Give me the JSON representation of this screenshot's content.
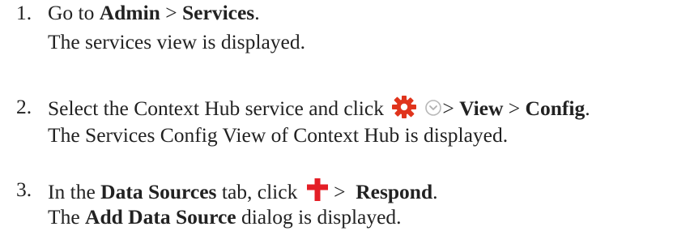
{
  "steps": [
    {
      "number": "1.",
      "line1": {
        "prefix": "Go to ",
        "bold1": "Admin",
        "sep": " > ",
        "bold2": "Services",
        "end": "."
      },
      "line2": "The services view is displayed."
    },
    {
      "number": "2.",
      "line1": {
        "prefix": "Select the Context Hub service and click ",
        "sep1": "> ",
        "bold1": "View",
        "sep2": " > ",
        "bold2": "Config",
        "end": "."
      },
      "line2": " The Services Config View of Context Hub is displayed."
    },
    {
      "number": "3.",
      "line1": {
        "prefix": "In the ",
        "bold1": "Data Sources",
        "mid": " tab, click ",
        "sep": " >  ",
        "bold2": "Respond",
        "end": "."
      },
      "line2": {
        "prefix": "The ",
        "bold": "Add Data Source",
        "suffix": " dialog is displayed."
      }
    }
  ],
  "icons": {
    "gear": "gear-icon",
    "chevron": "chevron-down-circle-icon",
    "plus": "plus-icon"
  },
  "colors": {
    "text": "#222222",
    "gear_red": "#e0341c",
    "chevron_grey": "#b8b8b8",
    "plus_red": "#e41e26"
  }
}
